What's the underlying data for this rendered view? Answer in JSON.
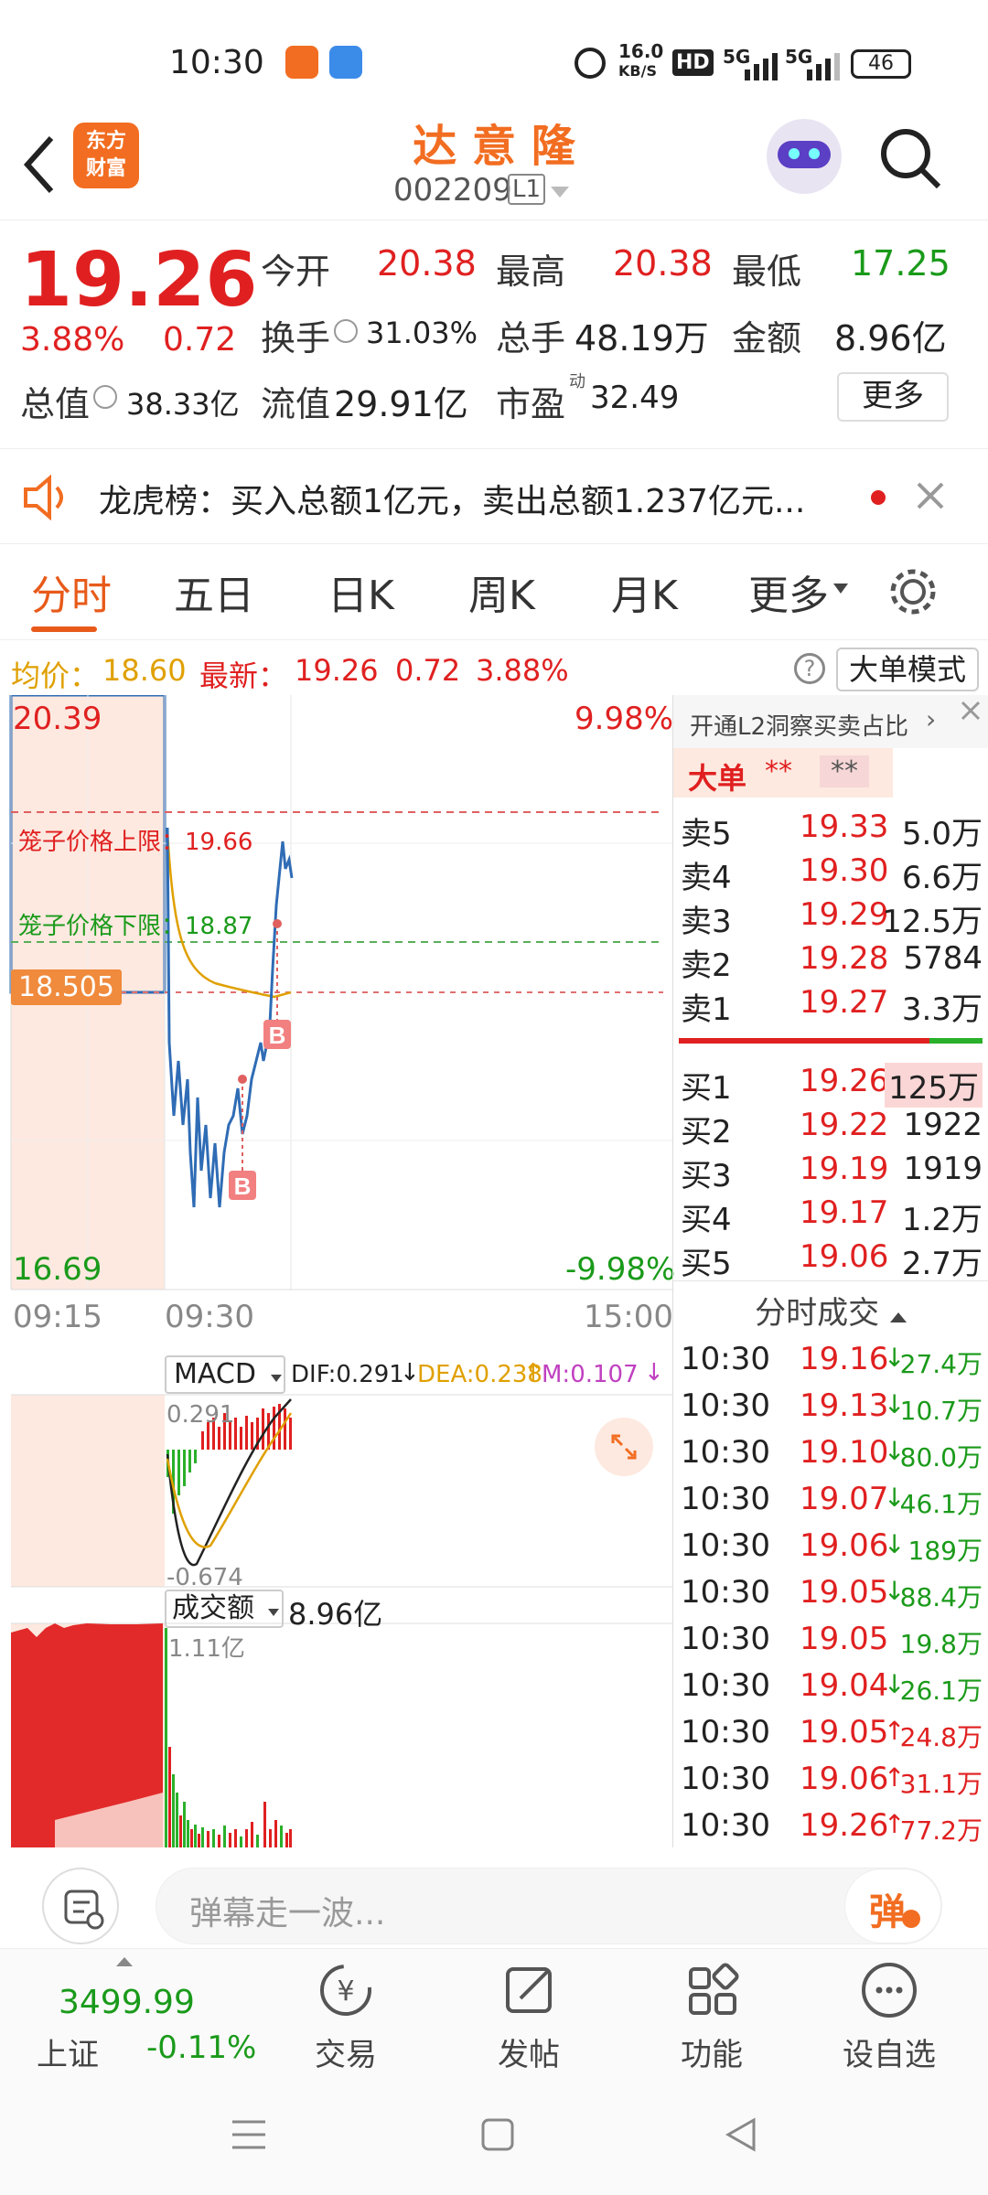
{
  "status": {
    "time": "10:30",
    "net_speed_top": "16.0",
    "net_speed_bottom": "KB/S",
    "hd": "HD",
    "sig1": "5G",
    "sig2": "5G",
    "battery": "46"
  },
  "header": {
    "back_icon": "chevron-left-icon",
    "logo_line1": "东方",
    "logo_line2": "财富",
    "stock_name": "达 意 隆",
    "stock_code": "002209",
    "level": "L1",
    "robot_icon": "robot-avatar",
    "search_icon": "search-icon"
  },
  "quote": {
    "price": "19.26",
    "change_pct": "3.88%",
    "change_amt": "0.72",
    "open_label": "今开",
    "open_val": "20.38",
    "high_label": "最高",
    "high_val": "20.38",
    "low_label": "最低",
    "low_val": "17.25",
    "turnover_label": "换手",
    "turnover_val": "31.03%",
    "volume_label": "总手",
    "volume_val": "48.19万",
    "amount_label": "金额",
    "amount_val": "8.96亿",
    "mktcap_label": "总值",
    "mktcap_val": "38.33亿",
    "float_label": "流值",
    "float_val": "29.91亿",
    "pe_label": "市盈",
    "pe_sup": "动",
    "pe_val": "32.49",
    "more_button": "更多"
  },
  "notice": {
    "text": "龙虎榜：买入总额1亿元，卖出总额1.237亿元..."
  },
  "tabs": [
    "分时",
    "五日",
    "日K",
    "周K",
    "月K",
    "更多"
  ],
  "avgbar": {
    "avg_label": "均价：",
    "avg_val": "18.60",
    "latest_label": "最新：",
    "latest_val": "19.26",
    "latest_chg": "0.72",
    "latest_pct": "3.88%",
    "mode_button": "大单模式"
  },
  "chart": {
    "y_top": "20.39",
    "y_bottom": "16.69",
    "pct_top": "9.98%",
    "pct_bottom": "-9.98%",
    "mid_tag": "18.505",
    "cage_upper": "笼子价格上限：19.66",
    "cage_lower": "笼子价格下限：18.87",
    "t_start": "09:15",
    "t_open": "09:30",
    "t_close": "15:00",
    "marker": "B",
    "macd_label": "MACD",
    "dif": "DIF:0.291",
    "dea": "DEA:0.238",
    "m": "M:0.107",
    "macd_top": "0.291",
    "macd_bottom": "-0.674",
    "vol_label": "成交额",
    "vol_total": "8.96亿",
    "vol_max": "1.11亿"
  },
  "orderbook": {
    "l2_banner": "开通L2洞察买卖占比",
    "big_label": "大单",
    "big_mask1": "**",
    "big_mask2": "**",
    "asks": [
      {
        "label": "卖5",
        "price": "19.33",
        "vol": "5.0万"
      },
      {
        "label": "卖4",
        "price": "19.30",
        "vol": "6.6万"
      },
      {
        "label": "卖3",
        "price": "19.29",
        "vol": "12.5万"
      },
      {
        "label": "卖2",
        "price": "19.28",
        "vol": "5784"
      },
      {
        "label": "卖1",
        "price": "19.27",
        "vol": "3.3万"
      }
    ],
    "bids": [
      {
        "label": "买1",
        "price": "19.26",
        "vol": "125万"
      },
      {
        "label": "买2",
        "price": "19.22",
        "vol": "1922"
      },
      {
        "label": "买3",
        "price": "19.19",
        "vol": "1919"
      },
      {
        "label": "买4",
        "price": "19.17",
        "vol": "1.2万"
      },
      {
        "label": "买5",
        "price": "19.06",
        "vol": "2.7万"
      }
    ],
    "trades_title": "分时成交",
    "trades": [
      {
        "time": "10:30",
        "price": "19.16",
        "dir": "↓",
        "vol": "27.4万"
      },
      {
        "time": "10:30",
        "price": "19.13",
        "dir": "↓",
        "vol": "10.7万"
      },
      {
        "time": "10:30",
        "price": "19.10",
        "dir": "↓",
        "vol": "80.0万"
      },
      {
        "time": "10:30",
        "price": "19.07",
        "dir": "↓",
        "vol": "46.1万"
      },
      {
        "time": "10:30",
        "price": "19.06",
        "dir": "↓",
        "vol": "189万"
      },
      {
        "time": "10:30",
        "price": "19.05",
        "dir": "↓",
        "vol": "88.4万"
      },
      {
        "time": "10:30",
        "price": "19.05",
        "dir": "",
        "vol": "19.8万"
      },
      {
        "time": "10:30",
        "price": "19.04",
        "dir": "↓",
        "vol": "26.1万"
      },
      {
        "time": "10:30",
        "price": "19.05",
        "dir": "↑",
        "vol": "24.8万"
      },
      {
        "time": "10:30",
        "price": "19.06",
        "dir": "↑",
        "vol": "31.1万"
      },
      {
        "time": "10:30",
        "price": "19.26",
        "dir": "↑",
        "vol": "77.2万"
      }
    ]
  },
  "danmu": {
    "placeholder": "弹幕走一波...",
    "send_label": "弹"
  },
  "bottomnav": {
    "index_val": "3499.99",
    "index_name": "上证",
    "index_pct": "-0.11%",
    "items": [
      "交易",
      "发帖",
      "功能",
      "设自选"
    ]
  },
  "colors": {
    "up": "#e02020",
    "down": "#1a9a1a",
    "brand": "#f26d21",
    "avg_line": "#e0a000",
    "price_line": "#2f6cb5"
  }
}
